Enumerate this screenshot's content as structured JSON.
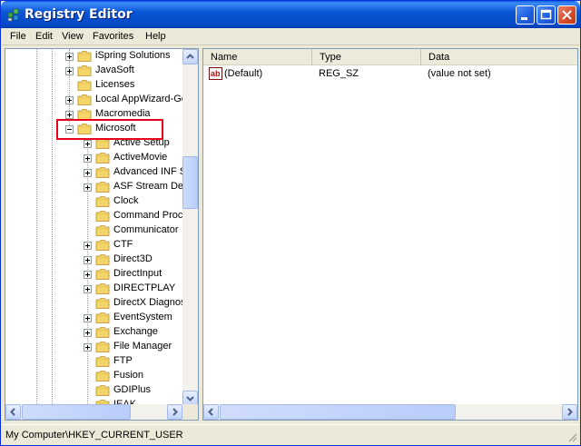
{
  "window": {
    "title": "Registry Editor"
  },
  "menu": [
    "File",
    "Edit",
    "View",
    "Favorites",
    "Help"
  ],
  "tree": {
    "items": [
      {
        "label": "iSpring Solutions",
        "expander": "plus",
        "level": 1
      },
      {
        "label": "JavaSoft",
        "expander": "plus",
        "level": 1
      },
      {
        "label": "Licenses",
        "expander": "none",
        "level": 1
      },
      {
        "label": "Local AppWizard-Ge",
        "expander": "plus",
        "level": 1
      },
      {
        "label": "Macromedia",
        "expander": "plus",
        "level": 1
      },
      {
        "label": "Microsoft",
        "expander": "minus",
        "level": 1
      },
      {
        "label": "Active Setup",
        "expander": "plus",
        "level": 2
      },
      {
        "label": "ActiveMovie",
        "expander": "plus",
        "level": 2
      },
      {
        "label": "Advanced INF S",
        "expander": "plus",
        "level": 2
      },
      {
        "label": "ASF Stream Des",
        "expander": "plus",
        "level": 2
      },
      {
        "label": "Clock",
        "expander": "none",
        "level": 2
      },
      {
        "label": "Command Proce",
        "expander": "none",
        "level": 2
      },
      {
        "label": "Communicator",
        "expander": "none",
        "level": 2
      },
      {
        "label": "CTF",
        "expander": "plus",
        "level": 2
      },
      {
        "label": "Direct3D",
        "expander": "plus",
        "level": 2
      },
      {
        "label": "DirectInput",
        "expander": "plus",
        "level": 2
      },
      {
        "label": "DIRECTPLAY",
        "expander": "plus",
        "level": 2
      },
      {
        "label": "DirectX Diagnos",
        "expander": "none",
        "level": 2
      },
      {
        "label": "EventSystem",
        "expander": "plus",
        "level": 2
      },
      {
        "label": "Exchange",
        "expander": "plus",
        "level": 2
      },
      {
        "label": "File Manager",
        "expander": "plus",
        "level": 2
      },
      {
        "label": "FTP",
        "expander": "none",
        "level": 2
      },
      {
        "label": "Fusion",
        "expander": "none",
        "level": 2
      },
      {
        "label": "GDIPlus",
        "expander": "none",
        "level": 2
      },
      {
        "label": "IEAK",
        "expander": "none",
        "level": 2
      }
    ]
  },
  "list": {
    "columns": [
      "Name",
      "Type",
      "Data"
    ],
    "rows": [
      {
        "name": "(Default)",
        "type": "REG_SZ",
        "data": "(value not set)"
      }
    ]
  },
  "status": {
    "path": "My Computer\\HKEY_CURRENT_USER"
  },
  "colors": {
    "title_blue": "#0a57d6",
    "highlight_red": "#e8001c",
    "folder_yellow": "#f5d66b"
  }
}
